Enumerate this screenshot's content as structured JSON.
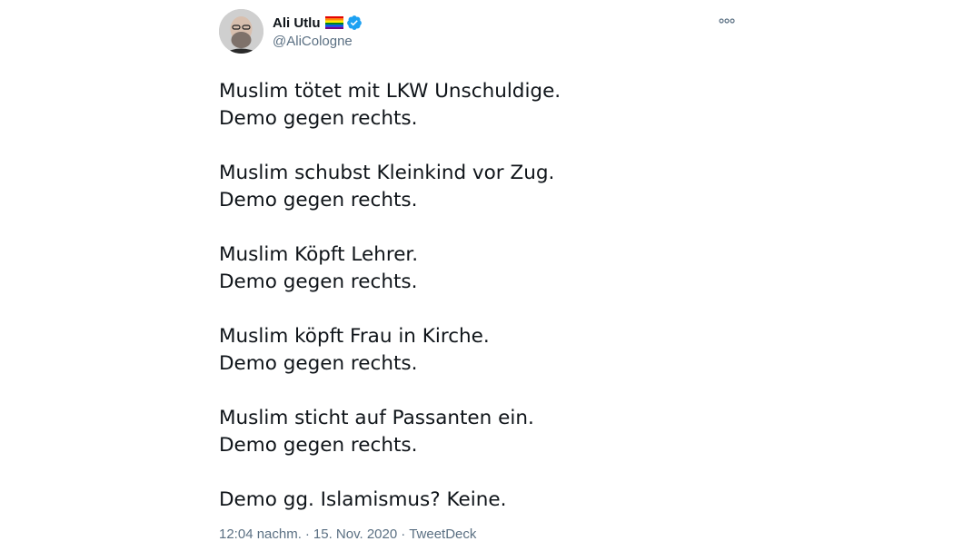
{
  "author": {
    "display_name": "Ali Utlu",
    "handle": "@AliCologne",
    "avatar_icon": "avatar-photo",
    "flag_icon": "rainbow-flag-icon",
    "verified_icon": "verified-badge-icon",
    "verified_color": "#1da1f2"
  },
  "more_icon": "more-options-icon",
  "stanzas": [
    [
      "Muslim tötet mit LKW Unschuldige.",
      "Demo gegen rechts."
    ],
    [
      "Muslim schubst Kleinkind vor Zug.",
      "Demo gegen rechts."
    ],
    [
      "Muslim Köpft Lehrer.",
      "Demo gegen rechts."
    ],
    [
      "Muslim köpft Frau in Kirche.",
      "Demo gegen rechts."
    ],
    [
      "Muslim sticht auf Passanten ein.",
      "Demo gegen rechts."
    ],
    [
      "Demo gg. Islamismus? Keine."
    ]
  ],
  "meta": {
    "time": "12:04 nachm.",
    "date": "15. Nov. 2020",
    "source": "TweetDeck",
    "separator": "·"
  },
  "colors": {
    "text": "#0f1419",
    "secondary": "#5b7083"
  }
}
